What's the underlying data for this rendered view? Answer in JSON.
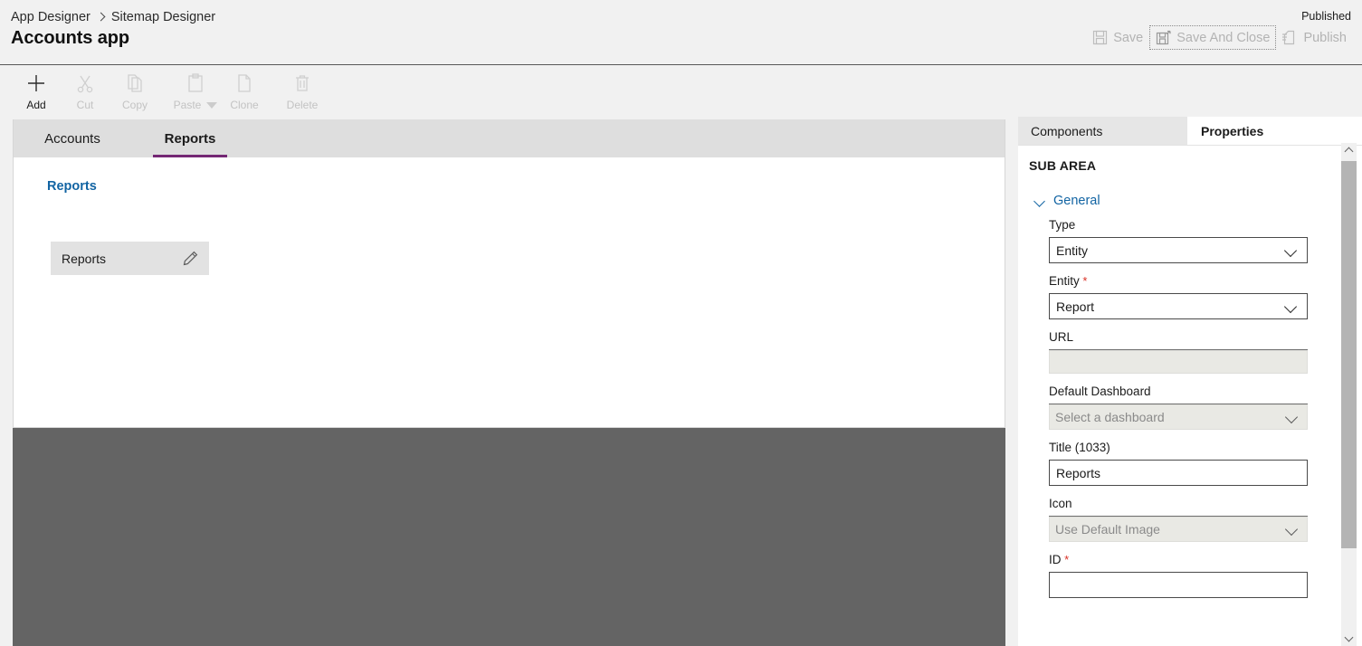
{
  "header": {
    "breadcrumb": [
      "App Designer",
      "Sitemap Designer"
    ],
    "app_title": "Accounts app",
    "published_status": "Published",
    "actions": [
      {
        "label": "Save",
        "icon": "save-icon",
        "enabled": false,
        "focused": false
      },
      {
        "label": "Save And Close",
        "icon": "save-and-close-icon",
        "enabled": false,
        "focused": true
      },
      {
        "label": "Publish",
        "icon": "publish-icon",
        "enabled": false,
        "focused": false
      }
    ]
  },
  "command_bar": {
    "commands": [
      {
        "label": "Add",
        "icon": "plus-icon",
        "enabled": true,
        "has_dropdown": false
      },
      {
        "label": "Cut",
        "icon": "scissors-icon",
        "enabled": false,
        "has_dropdown": false
      },
      {
        "label": "Copy",
        "icon": "copy-icon",
        "enabled": false,
        "has_dropdown": false
      },
      {
        "label": "Paste",
        "icon": "clipboard-icon",
        "enabled": false,
        "has_dropdown": true
      },
      {
        "label": "Clone",
        "icon": "clone-icon",
        "enabled": false,
        "has_dropdown": false
      },
      {
        "label": "Delete",
        "icon": "trash-icon",
        "enabled": false,
        "has_dropdown": false
      }
    ]
  },
  "canvas": {
    "tabs": [
      {
        "label": "Accounts",
        "active": false
      },
      {
        "label": "Reports",
        "active": true
      }
    ],
    "accent_color": "#742774",
    "group": {
      "title": "Reports",
      "title_color": "#1264a3",
      "tiles": [
        {
          "label": "Reports",
          "edit_icon": "pencil-icon"
        }
      ]
    }
  },
  "properties_panel": {
    "tabs": [
      {
        "label": "Components",
        "active": false
      },
      {
        "label": "Properties",
        "active": true
      }
    ],
    "subarea_header": "SUB AREA",
    "section": {
      "label": "General",
      "expanded": true,
      "color": "#1264a3"
    },
    "fields": [
      {
        "label": "Type",
        "required": false,
        "control": "select",
        "value": "Entity",
        "placeholder": "",
        "enabled": true
      },
      {
        "label": "Entity",
        "required": true,
        "control": "select",
        "value": "Report",
        "placeholder": "",
        "enabled": true
      },
      {
        "label": "URL",
        "required": false,
        "control": "text",
        "value": "",
        "placeholder": "",
        "enabled": false
      },
      {
        "label": "Default Dashboard",
        "required": false,
        "control": "select",
        "value": "",
        "placeholder": "Select a dashboard",
        "enabled": false
      },
      {
        "label": "Title (1033)",
        "required": false,
        "control": "text",
        "value": "Reports",
        "placeholder": "",
        "enabled": true
      },
      {
        "label": "Icon",
        "required": false,
        "control": "select",
        "value": "",
        "placeholder": "Use Default Image",
        "enabled": false
      },
      {
        "label": "ID",
        "required": true,
        "control": "text",
        "value": "",
        "placeholder": "",
        "enabled": true
      }
    ]
  },
  "scrollbar": {
    "up_icon": "chevron-up-icon",
    "down_icon": "chevron-down-icon"
  }
}
